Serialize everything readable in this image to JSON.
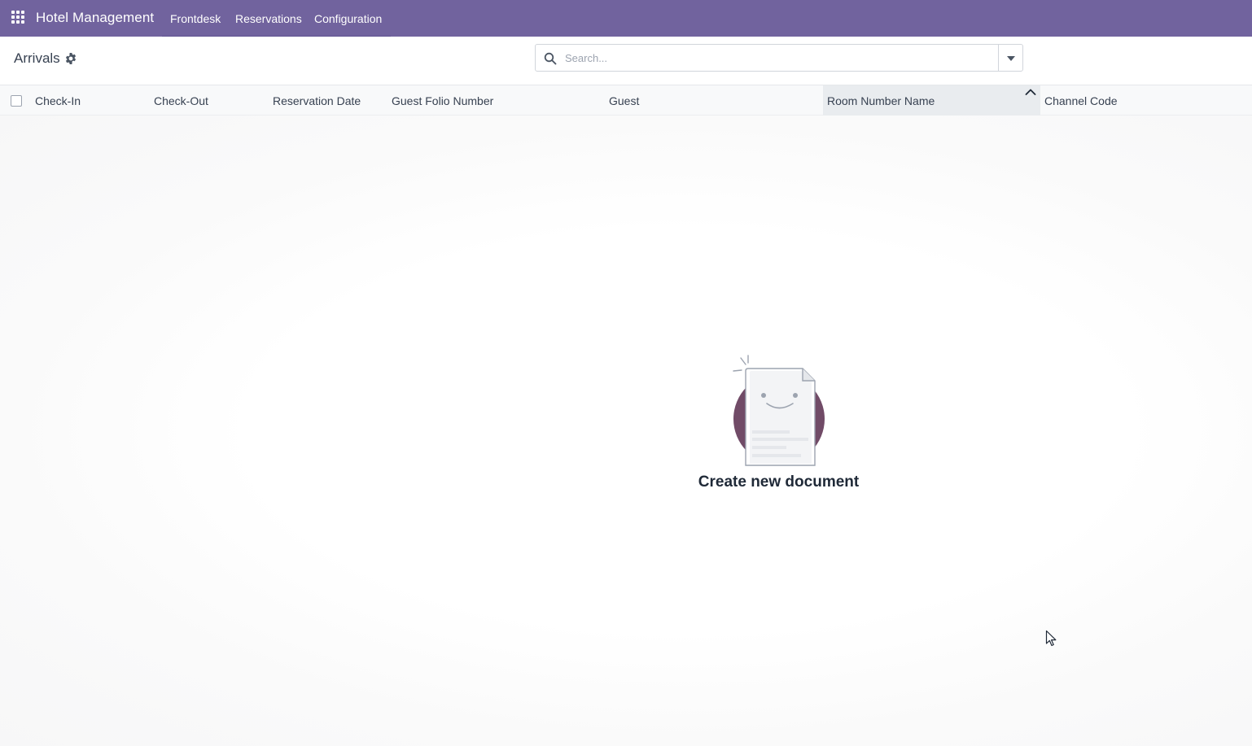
{
  "navbar": {
    "brand": "Hotel Management",
    "menu": [
      {
        "label": "Frontdesk"
      },
      {
        "label": "Reservations"
      },
      {
        "label": "Configuration"
      }
    ],
    "bg_color": "#71639e",
    "apps_icon": "grid-icon"
  },
  "control_panel": {
    "breadcrumb": "Arrivals",
    "settings_icon": "gear-icon",
    "search": {
      "placeholder": "Search...",
      "value": "",
      "icon": "search-icon",
      "toggle_icon": "caret-down-icon"
    }
  },
  "table": {
    "columns": [
      {
        "label": "Check-In"
      },
      {
        "label": "Check-Out"
      },
      {
        "label": "Reservation Date"
      },
      {
        "label": "Guest Folio Number"
      },
      {
        "label": "Guest"
      },
      {
        "label": "Room Number Name",
        "sorted": "ascending"
      },
      {
        "label": "Channel Code"
      }
    ],
    "rows": []
  },
  "empty_state": {
    "title": "Create new document",
    "icon": "smiling-document-icon",
    "accent_color": "#714b67"
  }
}
